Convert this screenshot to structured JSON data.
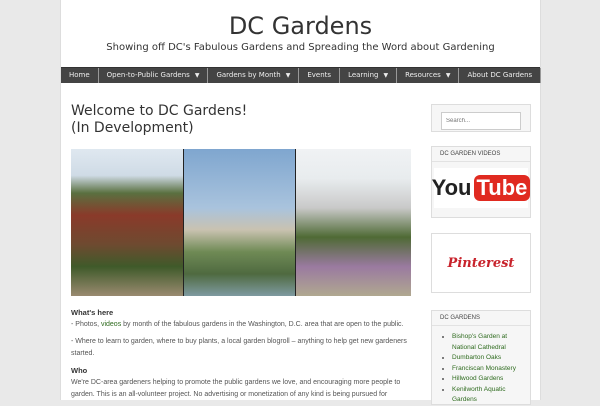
{
  "site": {
    "title": "DC Gardens",
    "tagline": "Showing off DC's Fabulous Gardens and Spreading the Word about Gardening"
  },
  "nav": [
    {
      "label": "Home",
      "dropdown": false
    },
    {
      "label": "Open-to-Public Gardens",
      "dropdown": true
    },
    {
      "label": "Gardens by Month",
      "dropdown": true
    },
    {
      "label": "Events",
      "dropdown": false
    },
    {
      "label": "Learning",
      "dropdown": true
    },
    {
      "label": "Resources",
      "dropdown": true
    },
    {
      "label": "About DC Gardens",
      "dropdown": false
    }
  ],
  "post": {
    "title_line1": "Welcome to DC Gardens!",
    "title_line2": "(In Development)",
    "whats_here": "What's here",
    "p1_pre": "- Photos, ",
    "p1_link": "videos",
    "p1_post": " by month of the fabulous gardens in the Washington, D.C. area that are open to the public.",
    "p2": "- Where to learn to garden, where to buy plants, a local garden blogroll – anything to help get new gardeners started.",
    "who": "Who",
    "p3": "We're DC-area gardeners helping to promote the public gardens we love, and encouraging more people to garden.  This is an all-volunteer project.  No advertising or monetization of any kind is being pursued for"
  },
  "sidebar": {
    "search_placeholder": "Search...",
    "videos_title": "DC GARDEN VIDEOS",
    "youtube_you": "You",
    "youtube_tube": "Tube",
    "pinterest": "Pinterest",
    "gardens_title": "DC GARDENS",
    "gardens": [
      "Bishop's Garden at National Cathedral",
      "Dumbarton Oaks",
      "Franciscan Monastery",
      "Hillwood Gardens",
      "Kenilworth Aquatic Gardens"
    ]
  }
}
